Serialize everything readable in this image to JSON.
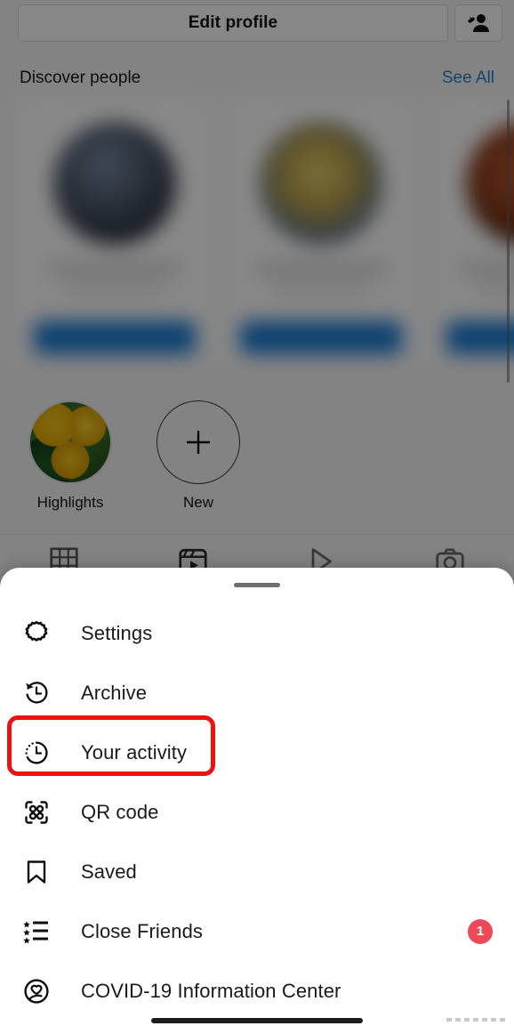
{
  "app": "instagram-profile",
  "background": {
    "edit_profile_label": "Edit profile",
    "add_person_icon": "add-person-icon",
    "discover": {
      "title": "Discover people",
      "see_all_label": "See All",
      "see_all_color": "#1d7fd3",
      "cards": [
        {
          "avatar": "blurred-avatar-1",
          "follow_label": ""
        },
        {
          "avatar": "blurred-avatar-2",
          "follow_label": ""
        },
        {
          "avatar": "blurred-avatar-3",
          "follow_label": ""
        }
      ],
      "follow_button_color": "#1877cf"
    },
    "highlights": [
      {
        "label": "Highlights",
        "thumb": "flower-photo"
      },
      {
        "label": "New",
        "thumb": "plus-icon"
      }
    ],
    "tabs": [
      {
        "icon": "grid-icon",
        "name": "posts-tab"
      },
      {
        "icon": "reels-icon",
        "name": "reels-tab"
      },
      {
        "icon": "igtv-icon",
        "name": "igtv-tab"
      },
      {
        "icon": "tagged-icon",
        "name": "tagged-tab"
      }
    ]
  },
  "sheet": {
    "handle": "drag-handle",
    "items": [
      {
        "label": "Settings",
        "icon": "gear-icon",
        "badge": null
      },
      {
        "label": "Archive",
        "icon": "archive-clock-icon",
        "badge": null
      },
      {
        "label": "Your activity",
        "icon": "activity-clock-icon",
        "badge": null,
        "highlighted": true
      },
      {
        "label": "QR code",
        "icon": "qr-code-icon",
        "badge": null
      },
      {
        "label": "Saved",
        "icon": "bookmark-icon",
        "badge": null
      },
      {
        "label": "Close Friends",
        "icon": "close-friends-list-icon",
        "badge": "1"
      },
      {
        "label": "COVID-19 Information Center",
        "icon": "covid-heart-icon",
        "badge": null
      }
    ],
    "highlight_color": "#ee1111",
    "badge_color": "#ed4956"
  }
}
